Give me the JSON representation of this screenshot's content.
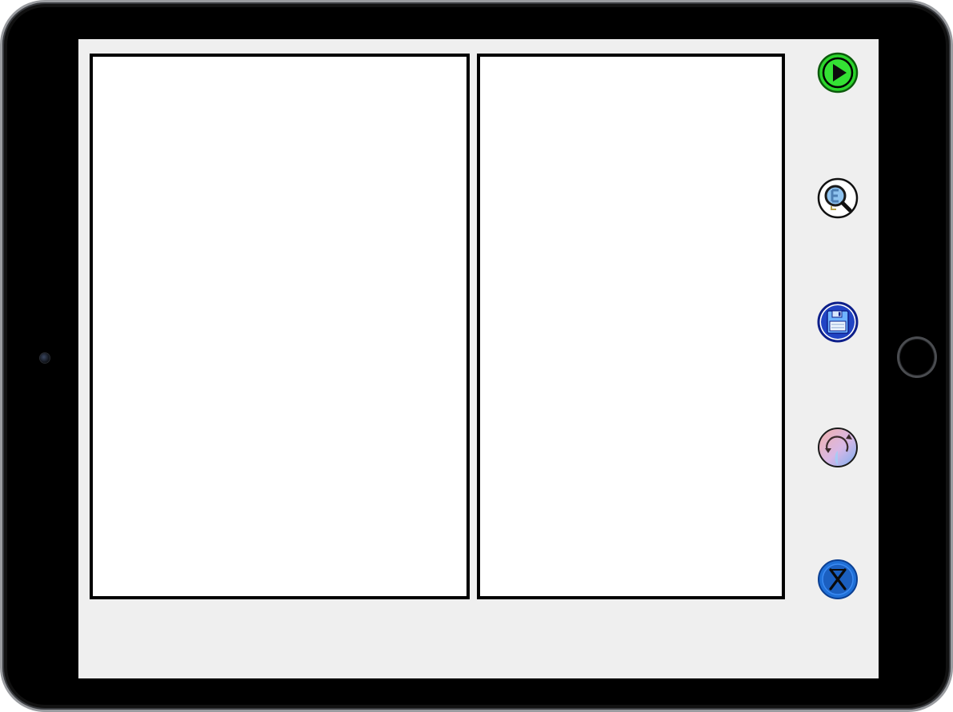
{
  "device": {
    "type": "tablet",
    "frame_color": "#000000",
    "bezel_edge_color": "#9a9ca0",
    "screen_background": "#efefef"
  },
  "workspace": {
    "left_panel": {
      "content": ""
    },
    "right_panel": {
      "content": ""
    }
  },
  "toolbar": {
    "buttons": [
      {
        "id": "play",
        "icon": "play-icon",
        "color": "#22cc22"
      },
      {
        "id": "search",
        "icon": "magnifier-icon",
        "color": "#6aa8e0"
      },
      {
        "id": "save",
        "icon": "floppy-disk-icon",
        "color": "#1f3fae"
      },
      {
        "id": "refresh",
        "icon": "refresh-icon",
        "color": "#e88a8a"
      },
      {
        "id": "close",
        "icon": "close-x-icon",
        "color": "#1f6fd6"
      }
    ]
  }
}
